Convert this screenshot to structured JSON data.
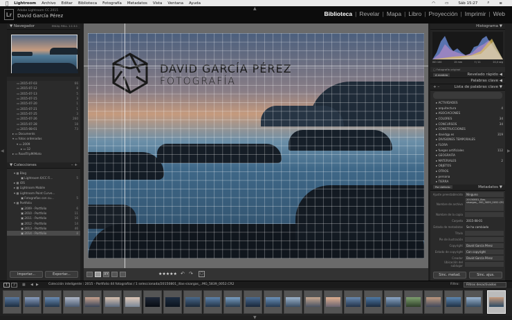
{
  "menubar": {
    "apple": "",
    "items": [
      "Lightroom",
      "Archivo",
      "Editar",
      "Biblioteca",
      "Fotografía",
      "Metadatos",
      "Vista",
      "Ventana",
      "Ayuda"
    ],
    "clock": "Sáb 15:27"
  },
  "identity": {
    "app": "Adobe Lightroom CC 2015",
    "user": "David García Pérez",
    "logo": "Lr"
  },
  "modules": [
    "Biblioteca",
    "Revelar",
    "Mapa",
    "Libro",
    "Proyección",
    "Imprimir",
    "Web"
  ],
  "active_module": "Biblioteca",
  "navigator": {
    "title": "Navegador",
    "options": "ENCAJ.  RELL.  1:1  4:1"
  },
  "folders": [
    {
      "name": "2015-07-03",
      "count": "66"
    },
    {
      "name": "2015-07-12",
      "count": "8"
    },
    {
      "name": "2015-07-13",
      "count": "5"
    },
    {
      "name": "2015-07-15",
      "count": "3"
    },
    {
      "name": "2015-07-20",
      "count": "1"
    },
    {
      "name": "2015-07-21",
      "count": "1"
    },
    {
      "name": "2015-07-25",
      "count": "3"
    },
    {
      "name": "2015-07-26",
      "count": "260"
    },
    {
      "name": "2015-07-28",
      "count": "18"
    },
    {
      "name": "2015-08-01",
      "count": "73"
    },
    {
      "name": "Documents",
      "count": ""
    },
    {
      "name": "fotos ordenadas",
      "count": ""
    },
    {
      "name": "2009",
      "count": ""
    },
    {
      "name": "12",
      "count": ""
    },
    {
      "name": "RoadTripMiMoto",
      "count": ""
    }
  ],
  "collections": {
    "title": "Colecciones",
    "items": [
      {
        "name": "Blog",
        "count": ""
      },
      {
        "name": "Lightroom 6/CC Fi...",
        "count": "5"
      },
      {
        "name": "iOS",
        "count": ""
      },
      {
        "name": "Lightroom Mobile",
        "count": ""
      },
      {
        "name": "Lightroom Point Curve...",
        "count": ""
      },
      {
        "name": "Fotografías con cu...",
        "count": "5"
      },
      {
        "name": "Portfolio",
        "count": ""
      },
      {
        "name": "2009 - Portfolio",
        "count": "6"
      },
      {
        "name": "2010 - Portfolio",
        "count": "11"
      },
      {
        "name": "2011 - Portfolio",
        "count": "16"
      },
      {
        "name": "2012 - Portfolio",
        "count": "14"
      },
      {
        "name": "2013 - Portfolio",
        "count": "46"
      },
      {
        "name": "2014 - Portfolio",
        "count": "8"
      }
    ]
  },
  "left_buttons": {
    "import": "Importar...",
    "export": "Exportar..."
  },
  "watermark": {
    "line1": "DAVID GARCÍA PÉREZ",
    "line2": "FOTOGRAFÍA"
  },
  "toolbar": {
    "stars": "★★★★★"
  },
  "histogram": {
    "title": "Histograma",
    "readout": [
      "ISO 100",
      "15 mm",
      "f / 11",
      "20,0 seg"
    ],
    "original": "Fotografía original"
  },
  "quick_develop": {
    "preset": "A medida",
    "title": "Revelado rápido"
  },
  "keywords_title": "Palabras clave",
  "keyword_list": {
    "title": "Lista de palabras clave",
    "items": [
      {
        "name": "ACTIVIDADES",
        "count": ""
      },
      {
        "name": "arquitectura",
        "count": "4"
      },
      {
        "name": "ASOCIACIONES",
        "count": ""
      },
      {
        "name": "COLORES",
        "count": "34"
      },
      {
        "name": "CONCURSOS",
        "count": "34"
      },
      {
        "name": "CONSTRUCCIONES",
        "count": ""
      },
      {
        "name": "davidgp.es",
        "count": "319"
      },
      {
        "name": "DIVISIONES TEMPORALES",
        "count": ""
      },
      {
        "name": "FLORA",
        "count": ""
      },
      {
        "name": "fuegos artificiales",
        "count": "112"
      },
      {
        "name": "GEOGRAFÍA",
        "count": ""
      },
      {
        "name": "MATERIALES",
        "count": "2"
      },
      {
        "name": "OBJETOS",
        "count": ""
      },
      {
        "name": "OTROS",
        "count": ""
      },
      {
        "name": "persona",
        "count": ""
      },
      {
        "name": "TIERRA",
        "count": ""
      }
    ]
  },
  "metadata": {
    "preset": "Por defecto",
    "title": "Metadatos",
    "rows": [
      {
        "label": "Ajuste preestablecido",
        "value": "Ninguno"
      },
      {
        "label": "Nombre de archivo",
        "value": "20150801_Illas-sisargas_..MG_5839_0052.CR2"
      },
      {
        "label": "Nombre de la copia",
        "value": ""
      },
      {
        "label": "Carpeta",
        "value": "2015-08-01"
      },
      {
        "label": "Estado de metadatos",
        "value": "Se ha cambiado"
      },
      {
        "label": "Título",
        "value": ""
      },
      {
        "label": "Pie de ilustración",
        "value": ""
      },
      {
        "label": "Copyright",
        "value": "David García Pérez"
      },
      {
        "label": "Estado de copyright",
        "value": "Con copyright"
      },
      {
        "label": "Creador",
        "value": "David García Pérez"
      },
      {
        "label": "Ubicación del sublugar",
        "value": ""
      }
    ]
  },
  "right_buttons": {
    "sync_meta": "Sinc. metad.",
    "sync_settings": "Sinc. ajus."
  },
  "bottombar": {
    "screens": [
      "1",
      "2"
    ],
    "path": "Colección inteligente : 2015 - Portfolio     44 fotografías / 1 seleccionada/20150801_illas-sisargas_..MG_5839_0052.CR2",
    "filter": "Filtro:",
    "filter_value": "Filtros desactivados"
  },
  "colors": {
    "accent": "#ffffff",
    "panel": "#2a2a2a"
  }
}
